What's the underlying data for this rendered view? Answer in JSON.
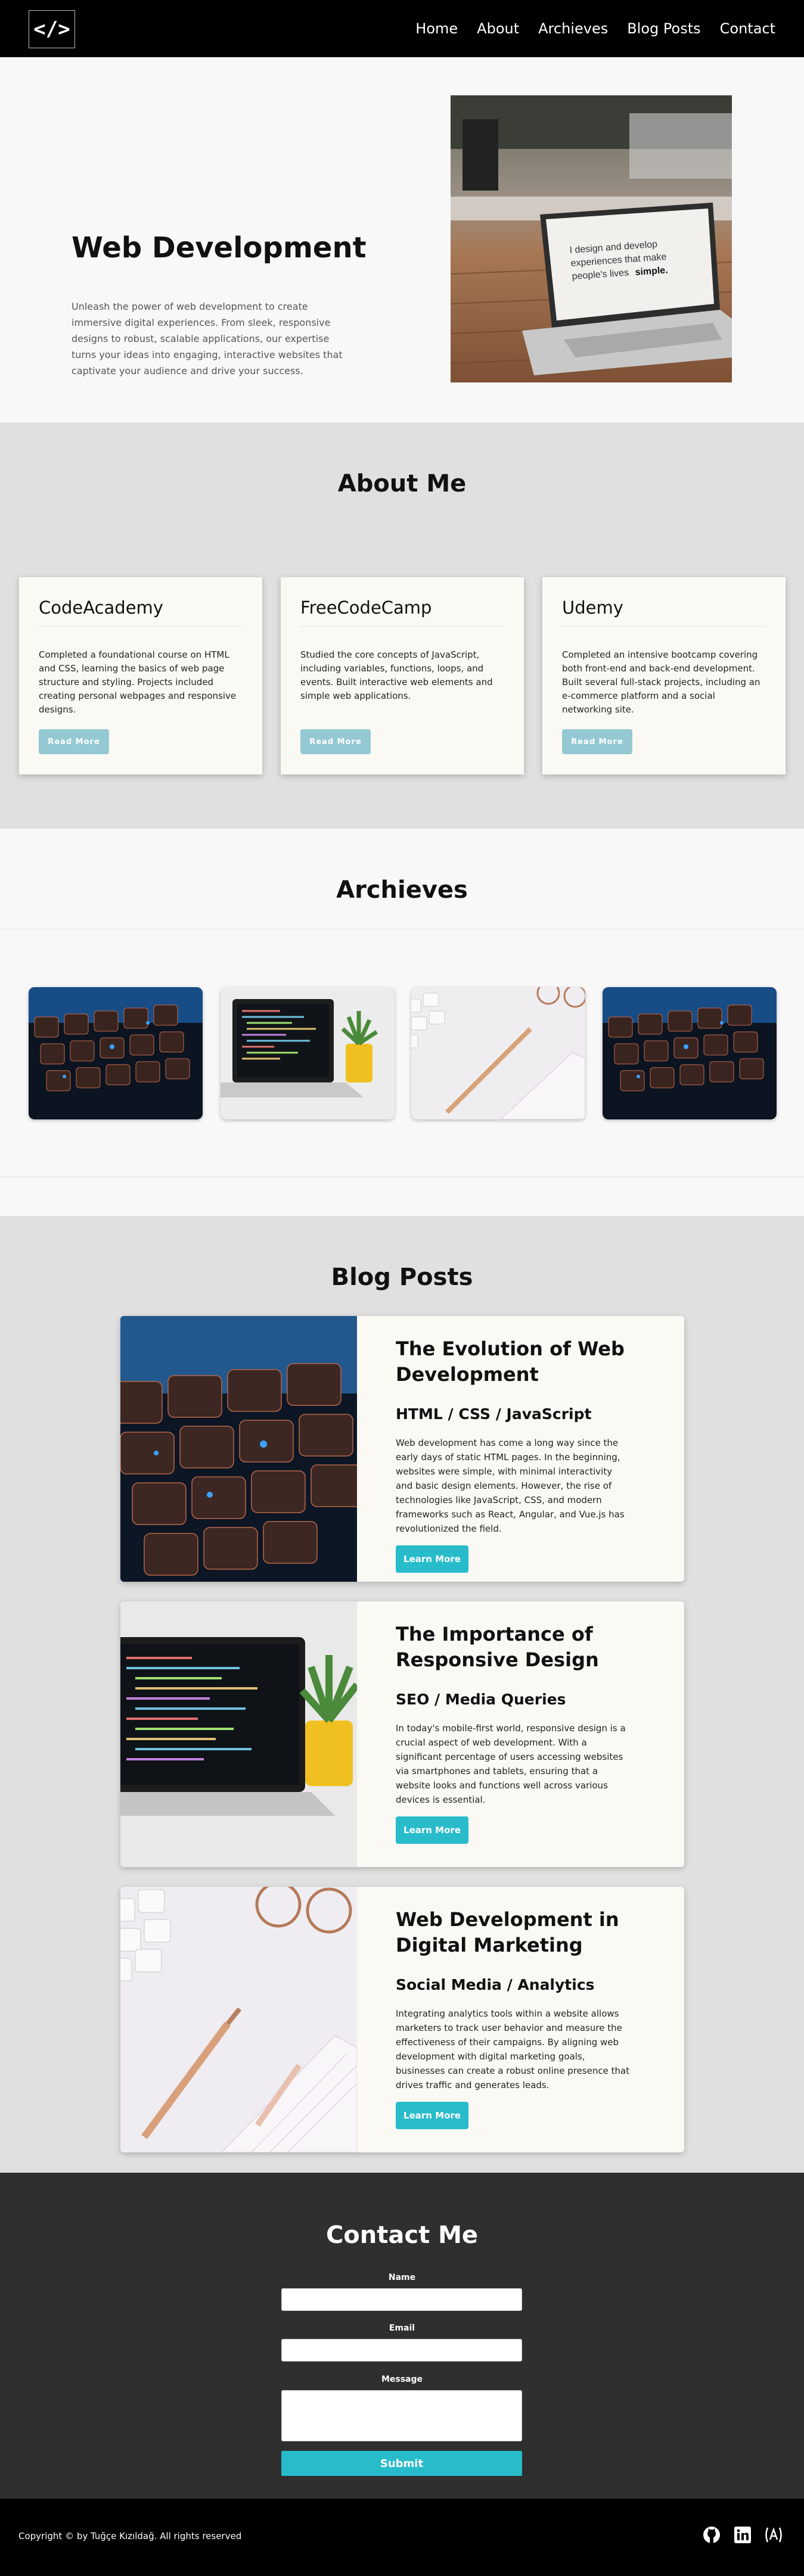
{
  "header": {
    "logo_glyph": "</>",
    "nav": [
      "Home",
      "About",
      "Archieves",
      "Blog Posts",
      "Contact"
    ]
  },
  "hero": {
    "title": "Web Development",
    "text": "Unleash the power of web development to create immersive digital experiences. From sleek, responsive designs to robust, scalable applications, our expertise turns your ideas into engaging, interactive websites that captivate your audience and drive your success.",
    "laptop_screen_text_1": "I design and develop",
    "laptop_screen_text_2": "experiences that make",
    "laptop_screen_text_3": "people's lives",
    "laptop_screen_text_4": "simple."
  },
  "about": {
    "title": "About Me",
    "cards": [
      {
        "title": "CodeAcademy",
        "text": "Completed a foundational course on HTML and CSS, learning the basics of web page structure and styling. Projects included creating personal webpages and responsive designs.",
        "button": "Read More"
      },
      {
        "title": "FreeCodeCamp",
        "text": "Studied the core concepts of JavaScript, including variables, functions, loops, and events. Built interactive web elements and simple web applications.",
        "button": "Read More"
      },
      {
        "title": "Udemy",
        "text": "Completed an intensive bootcamp covering both front-end and back-end development. Built several full-stack projects, including an e-commerce platform and a social networking site.",
        "button": "Read More"
      }
    ]
  },
  "archives": {
    "title": "Archieves",
    "images": [
      "keyboard-photo",
      "laptop-code-photo",
      "desk-pen-photo",
      "keyboard-photo"
    ]
  },
  "blog": {
    "title": "Blog Posts",
    "posts": [
      {
        "title": "The Evolution of Web Development",
        "subtitle": "HTML / CSS / JavaScript",
        "text": "Web development has come a long way since the early days of static HTML pages. In the beginning, websites were simple, with minimal interactivity and basic design elements. However, the rise of technologies like JavaScript, CSS, and modern frameworks such as React, Angular, and Vue.js has revolutionized the field.",
        "button": "Learn More"
      },
      {
        "title": "The Importance of Responsive Design",
        "subtitle": "SEO / Media Queries",
        "text": "In today's mobile-first world, responsive design is a crucial aspect of web development. With a significant percentage of users accessing websites via smartphones and tablets, ensuring that a website looks and functions well across various devices is essential.",
        "button": "Learn More"
      },
      {
        "title": "Web Development in Digital Marketing",
        "subtitle": "Social Media / Analytics",
        "text": "Integrating analytics tools within a website allows marketers to track user behavior and measure the effectiveness of their campaigns. By aligning web development with digital marketing goals, businesses can create a robust online presence that drives traffic and generates leads.",
        "button": "Learn More"
      }
    ]
  },
  "contact": {
    "title": "Contact Me",
    "name_label": "Name",
    "email_label": "Email",
    "message_label": "Message",
    "submit": "Submit"
  },
  "footer": {
    "copyright": "Copyright © by Tuğçe Kızıldağ. All rights reserved",
    "icons": [
      "github-icon",
      "linkedin-icon",
      "a-logo-icon"
    ]
  },
  "colors": {
    "accent": "#28bccb",
    "read_more": "#94c9d3",
    "header_bg": "#000000",
    "contact_bg": "#2f2f2f",
    "section_gray": "#e0e0e0"
  }
}
